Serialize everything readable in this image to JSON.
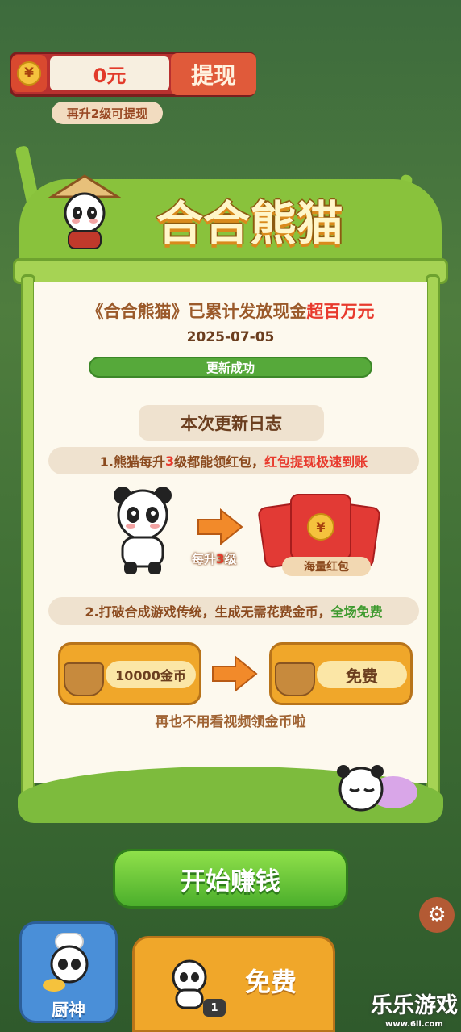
{
  "balance": {
    "currency_symbol": "¥",
    "amount": "0元",
    "withdraw_label": "提现",
    "hint": "再升2级可提现"
  },
  "title": "合合熊猫",
  "card": {
    "headline_prefix": "《合合熊猫》已累计发放现金",
    "headline_highlight": "超百万元",
    "date": "2025-07-05",
    "status": "更新成功",
    "log_title": "本次更新日志",
    "item1": {
      "prefix": "1.熊猫每升",
      "num": "3",
      "mid": "级都能领红包，",
      "highlight": "红包提现极速到账"
    },
    "arrow1_label_prefix": "每升",
    "arrow1_label_num": "3",
    "arrow1_label_suffix": "级",
    "envelope_symbol": "¥",
    "envelope_label": "海量红包",
    "item2": {
      "prefix": "2.打破合成游戏传统，生成无需花费金币，",
      "highlight": "全场免费"
    },
    "coin_cost": "10000金币",
    "free_label": "免费",
    "footnote": "再也不用看视频领金币啦"
  },
  "start_button": "开始赚钱",
  "chef": {
    "label": "厨神"
  },
  "free_card": {
    "label": "免费",
    "count": "1"
  },
  "watermark": {
    "main": "乐乐游戏",
    "sub": "www.6ll.com"
  },
  "colors": {
    "accent_green": "#56a93a",
    "accent_red": "#e83a2d",
    "accent_orange": "#f0a72a"
  }
}
